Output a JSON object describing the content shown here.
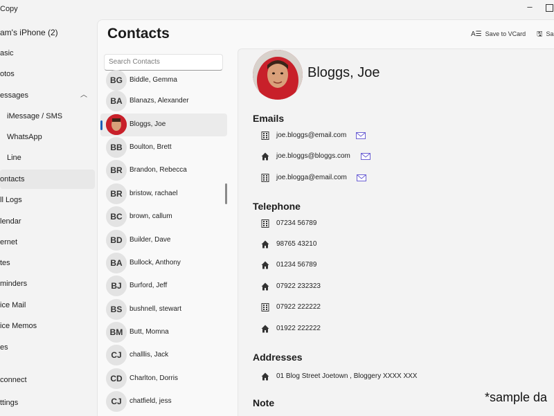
{
  "app": {
    "title": "Copy"
  },
  "sidebar": {
    "device_name": "am's iPhone (2)",
    "items": [
      {
        "label": "asic"
      },
      {
        "label": "otos"
      },
      {
        "label": "essages"
      },
      {
        "label": "iMessage / SMS"
      },
      {
        "label": "WhatsApp"
      },
      {
        "label": "Line"
      },
      {
        "label": "ontacts"
      },
      {
        "label": "ll Logs"
      },
      {
        "label": "lendar"
      },
      {
        "label": "ernet"
      },
      {
        "label": "tes"
      },
      {
        "label": "minders"
      },
      {
        "label": "ice Mail"
      },
      {
        "label": "ice Memos"
      },
      {
        "label": "es"
      },
      {
        "label": "connect"
      },
      {
        "label": "ttings"
      }
    ]
  },
  "header": {
    "title": "Contacts"
  },
  "toolbar": {
    "save_vcard_label": "Save to VCard",
    "second_label": "Sa"
  },
  "search": {
    "placeholder": "Search Contacts"
  },
  "contacts": [
    {
      "initials": "BG",
      "name": "Biddle, Gemma"
    },
    {
      "initials": "BA",
      "name": "Blanazs, Alexander"
    },
    {
      "initials": "",
      "name": "Bloggs, Joe"
    },
    {
      "initials": "BB",
      "name": "Boulton, Brett"
    },
    {
      "initials": "BR",
      "name": "Brandon, Rebecca"
    },
    {
      "initials": "BR",
      "name": "bristow, rachael"
    },
    {
      "initials": "BC",
      "name": "brown, callum"
    },
    {
      "initials": "BD",
      "name": "Builder, Dave"
    },
    {
      "initials": "BA",
      "name": "Bullock, Anthony"
    },
    {
      "initials": "BJ",
      "name": "Burford, Jeff"
    },
    {
      "initials": "BS",
      "name": "bushnell, stewart"
    },
    {
      "initials": "BM",
      "name": "Butt, Momna"
    },
    {
      "initials": "CJ",
      "name": "challlis, Jack"
    },
    {
      "initials": "CD",
      "name": "Charlton, Dorris"
    },
    {
      "initials": "CJ",
      "name": "chatfield, jess"
    }
  ],
  "detail": {
    "name": "Bloggs, Joe",
    "emails_heading": "Emails",
    "emails": [
      {
        "icon": "building-icon",
        "value": "joe.bloggs@email.com"
      },
      {
        "icon": "home-icon",
        "value": "joe.bloggs@bloggs.com"
      },
      {
        "icon": "building-icon",
        "value": "joe.blogga@email.com"
      }
    ],
    "telephone_heading": "Telephone",
    "phones": [
      {
        "icon": "building-icon",
        "value": "07234 56789"
      },
      {
        "icon": "home-icon",
        "value": "98765 43210"
      },
      {
        "icon": "home-icon",
        "value": "01234 56789"
      },
      {
        "icon": "home-icon",
        "value": "07922 232323"
      },
      {
        "icon": "building-icon",
        "value": "07922 222222"
      },
      {
        "icon": "home-icon",
        "value": "01922 222222"
      }
    ],
    "addresses_heading": "Addresses",
    "addresses": [
      {
        "icon": "home-icon",
        "value": "01 Blog Street Joetown , Bloggery XXXX XXX"
      }
    ],
    "note_heading": "Note"
  },
  "overlay": {
    "watermark": "*sample da"
  },
  "colors": {
    "accent": "#1d5fb5",
    "mail_icon": "#6b5fd3",
    "avatar_red": "#c8202a"
  }
}
